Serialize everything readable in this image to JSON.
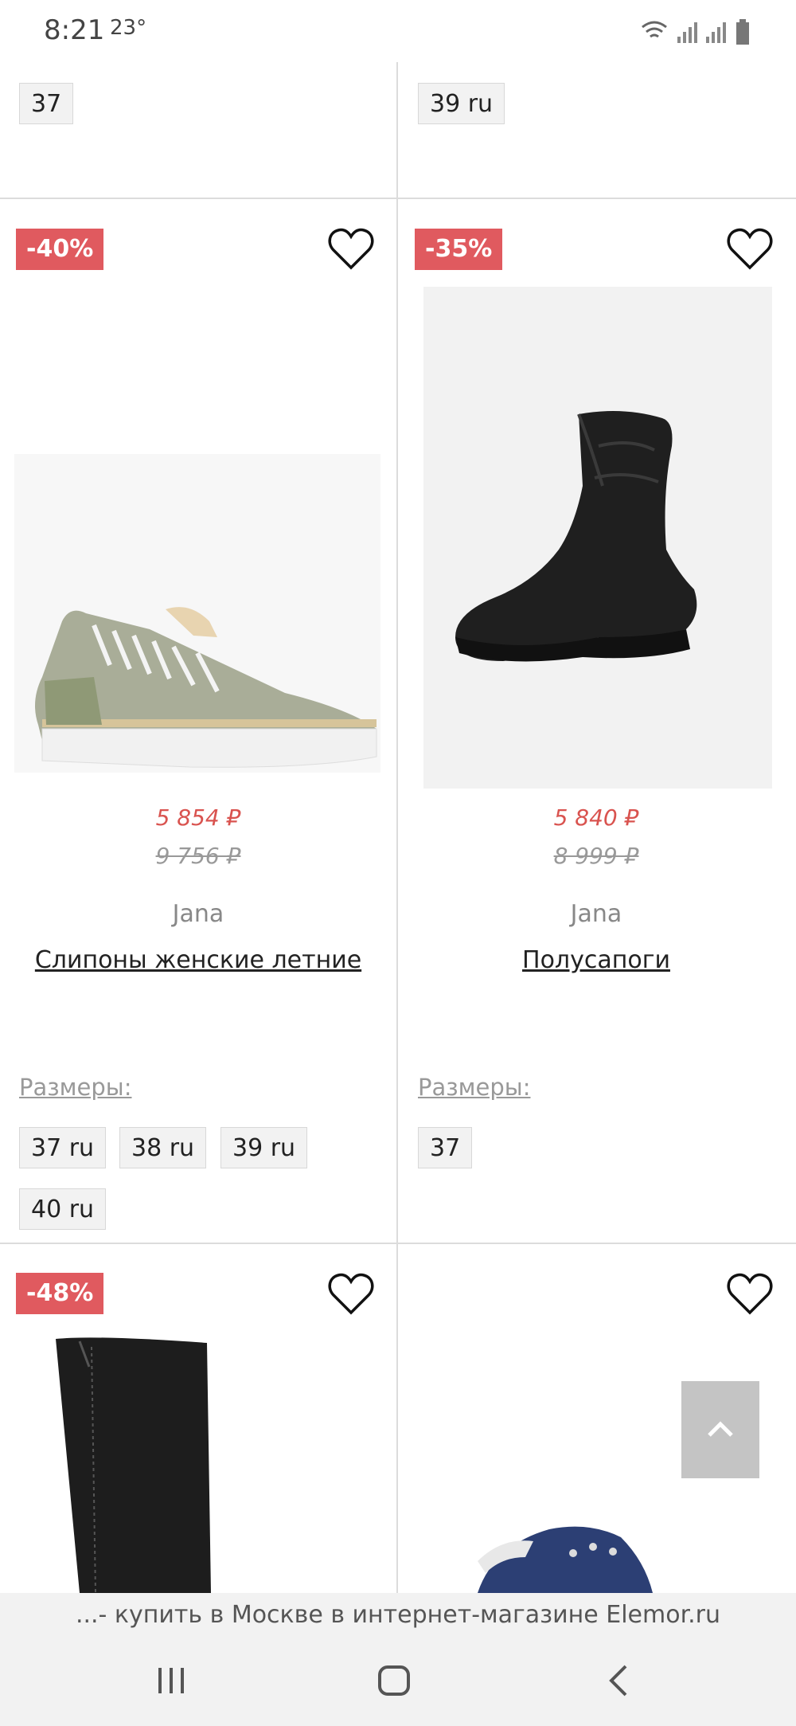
{
  "status_bar": {
    "time": "8:21",
    "temp": "23°"
  },
  "top_row": {
    "left_size": "37",
    "right_size": "39 ru"
  },
  "products": [
    {
      "discount": "-40%",
      "price_new": "5 854 ₽",
      "price_old": "9 756 ₽",
      "brand": "Jana",
      "name": "Слипоны женские летние",
      "sizes_label": "Размеры:",
      "sizes": [
        "37 ru",
        "38 ru",
        "39 ru",
        "40 ru"
      ]
    },
    {
      "discount": "-35%",
      "price_new": "5 840 ₽",
      "price_old": "8 999 ₽",
      "brand": "Jana",
      "name": "Полусапоги",
      "sizes_label": "Размеры:",
      "sizes": [
        "37"
      ]
    },
    {
      "discount": "-48%"
    },
    {}
  ],
  "browser": {
    "url_title": "...- купить в Москве в интернет-магазине Elemor.ru"
  },
  "icons": {
    "heart": "heart-icon",
    "scroll_top": "chevron-up-icon",
    "nav_recents": "recents-icon",
    "nav_home": "home-icon",
    "nav_back": "back-icon"
  },
  "colors": {
    "badge": "#e05a5f",
    "price_new": "#d9534f",
    "price_old": "#999999"
  }
}
